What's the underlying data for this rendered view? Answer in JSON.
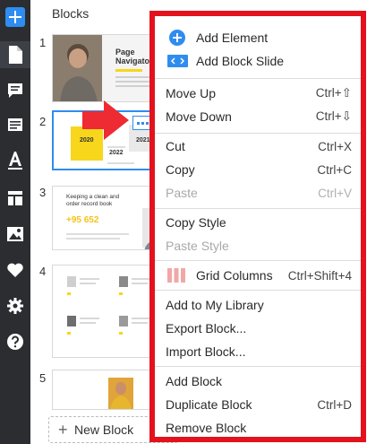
{
  "panel": {
    "title": "Blocks",
    "block_numbers": [
      "1",
      "2",
      "3",
      "4",
      "5"
    ],
    "new_block_label": "New Block"
  },
  "thumb1": {
    "heading": "Page Navigator"
  },
  "thumb2": {
    "years": [
      "2020",
      "2021",
      "2022"
    ]
  },
  "thumb3": {
    "heading": "Keeping a clean and order record book",
    "stat": "+95 652"
  },
  "menu": {
    "add_element": "Add Element",
    "add_block_slide": "Add Block Slide",
    "move_up": "Move Up",
    "move_up_sc": "Ctrl+⇧",
    "move_down": "Move Down",
    "move_down_sc": "Ctrl+⇩",
    "cut": "Cut",
    "cut_sc": "Ctrl+X",
    "copy": "Copy",
    "copy_sc": "Ctrl+C",
    "paste": "Paste",
    "paste_sc": "Ctrl+V",
    "copy_style": "Copy Style",
    "paste_style": "Paste Style",
    "grid_columns": "Grid Columns",
    "grid_columns_sc": "Ctrl+Shift+4",
    "add_to_library": "Add to My Library",
    "export_block": "Export Block...",
    "import_block": "Import Block...",
    "add_block": "Add Block",
    "duplicate_block": "Duplicate Block",
    "duplicate_block_sc": "Ctrl+D",
    "remove_block": "Remove Block"
  },
  "colors": {
    "accent": "#2f8cf0",
    "highlight_border": "#e3121d",
    "arrow": "#ee2a33",
    "thumb_yellow": "#f7d61c",
    "toolbar_bg": "#2b2d31"
  }
}
